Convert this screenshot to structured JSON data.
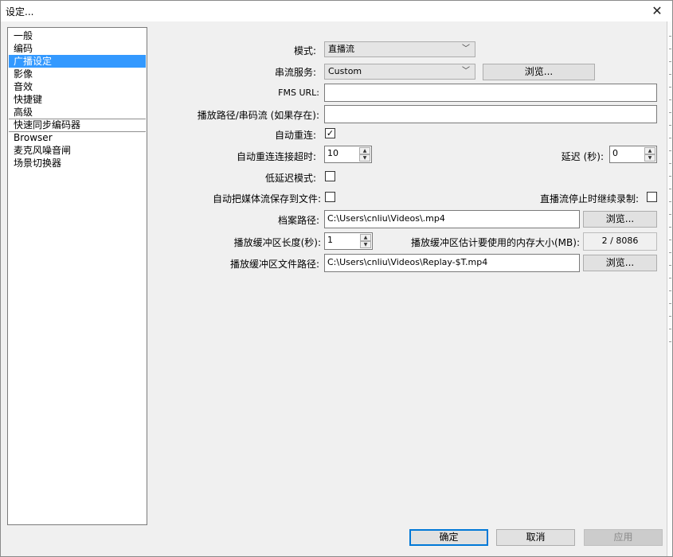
{
  "window": {
    "title": "设定...",
    "close_glyph": "✕"
  },
  "sidebar": {
    "items": [
      {
        "label": "一般"
      },
      {
        "label": "编码"
      },
      {
        "label": "广播设定",
        "selected": true
      },
      {
        "label": "影像"
      },
      {
        "label": "音效"
      },
      {
        "label": "快捷键"
      },
      {
        "label": "高级"
      },
      {
        "label": "快速同步编码器"
      },
      {
        "label": "Browser"
      },
      {
        "label": "麦克风噪音闸"
      },
      {
        "label": "场景切换器"
      }
    ]
  },
  "form": {
    "mode_label": "模式:",
    "mode_value": "直播流",
    "service_label": "串流服务:",
    "service_value": "Custom",
    "browse_label": "浏览...",
    "fms_label": "FMS URL:",
    "fms_value": "",
    "path_label": "播放路径/串码流 (如果存在):",
    "path_value": "",
    "auto_reconnect_label": "自动重连:",
    "auto_reconnect_checked": true,
    "auto_reconnect_timeout_label": "自动重连连接超时:",
    "auto_reconnect_timeout_value": "10",
    "delay_label": "延迟 (秒):",
    "delay_value": "0",
    "low_latency_label": "低延迟模式:",
    "low_latency_checked": false,
    "save_to_file_label": "自动把媒体流保存到文件:",
    "save_to_file_checked": false,
    "continue_recording_label": "直播流停止时继续录制:",
    "continue_recording_checked": false,
    "file_path_label": "档案路径:",
    "file_path_value": "C:\\Users\\cnliu\\Videos\\.mp4",
    "file_browse_label": "浏览...",
    "buffer_length_label": "播放缓冲区长度(秒):",
    "buffer_length_value": "1",
    "buffer_memory_label": "播放缓冲区估计要使用的内存大小(MB):",
    "buffer_memory_value": "2 / 8086",
    "buffer_file_label": "播放缓冲区文件路径:",
    "buffer_file_value": "C:\\Users\\cnliu\\Videos\\Replay-$T.mp4",
    "buffer_browse_label": "浏览..."
  },
  "footer": {
    "ok_label": "确定",
    "cancel_label": "取消",
    "apply_label": "应用"
  },
  "glyphs": {
    "dropdown_arrow": "﹀",
    "check": "✓",
    "spin_up": "▲",
    "spin_down": "▼"
  },
  "colors": {
    "selection": "#3399ff",
    "primary_border": "#0078d7",
    "dialog_bg": "#f0f0f0"
  }
}
